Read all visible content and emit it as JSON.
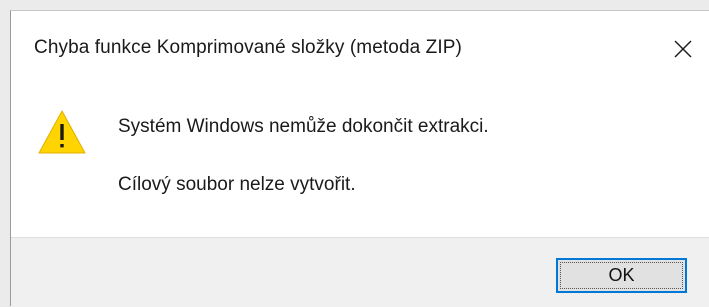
{
  "dialog": {
    "title": "Chyba funkce Komprimované složky (metoda ZIP)",
    "close_icon": "close-icon",
    "warning_icon": "warning-icon",
    "message_primary": "Systém Windows nemůže dokončit extrakci.",
    "message_secondary": "Cílový soubor nelze vytvořit.",
    "ok_label": "OK"
  },
  "colors": {
    "accent": "#0078d7",
    "warning_fill": "#ffd400",
    "footer_bg": "#f0f0f0"
  }
}
